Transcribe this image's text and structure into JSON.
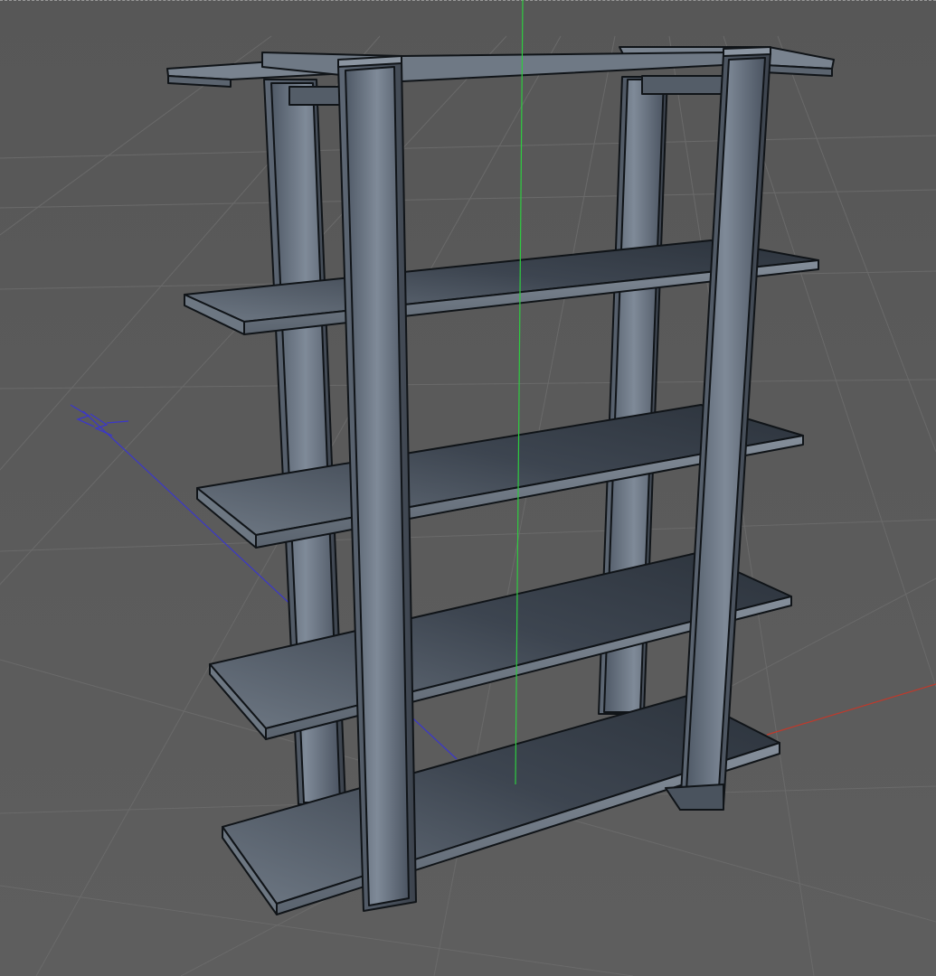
{
  "viewport": {
    "axis_label": "Z"
  },
  "colors": {
    "background": "#5a5a5a",
    "grid": "#6c6c6c",
    "axis_x": "#c0392b",
    "axis_y": "#2ecc40",
    "axis_z": "#3b37c9",
    "model_light": "#8a95a3",
    "model_dark": "#2f3640",
    "outline": "#101418"
  },
  "scene": {
    "object": "bookshelf",
    "shelf_count": 4,
    "post_count": 4
  }
}
